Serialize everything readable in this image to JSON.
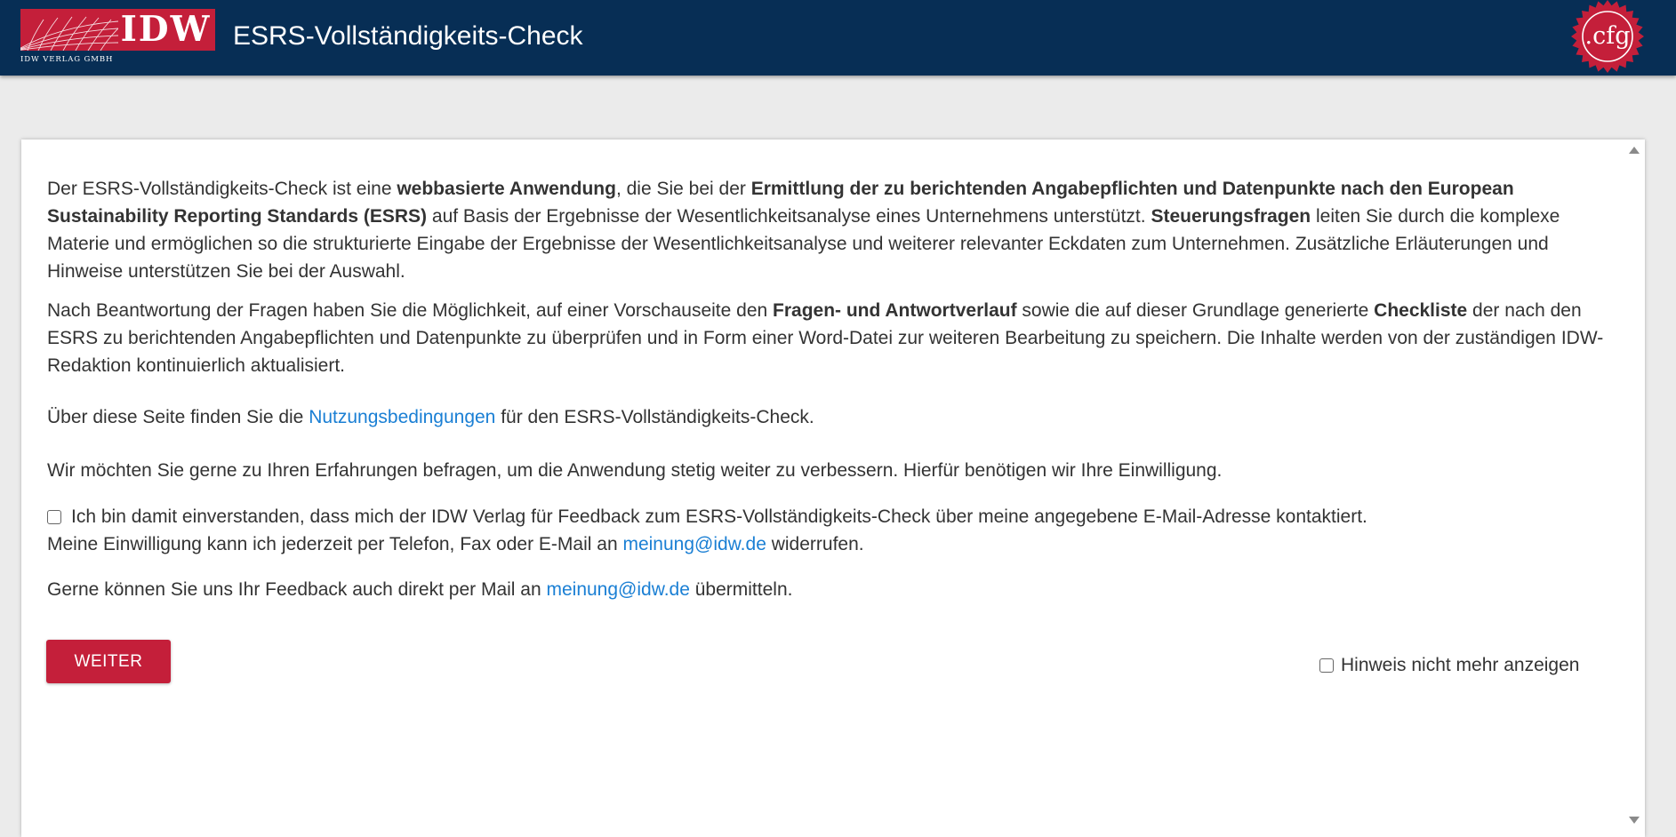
{
  "header": {
    "logo_text": "IDW",
    "logo_subtitle": "IDW VERLAG GMBH",
    "app_title": "ESRS-Vollständigkeits-Check",
    "badge_text": ".cfg"
  },
  "colors": {
    "header_bg": "#072e55",
    "brand_red": "#c41f3a",
    "link": "#1a7fd4",
    "page_bg": "#ebebeb"
  },
  "intro": {
    "p1": [
      {
        "t": "Der ESRS-Vollständigkeits-Check ist eine "
      },
      {
        "t": "webbasierte Anwendung",
        "b": true
      },
      {
        "t": ", die Sie bei der "
      },
      {
        "t": "Ermittlung der zu berichtenden Angabepflichten und Datenpunkte nach den European Sustainability Reporting Standards (ESRS)",
        "b": true
      },
      {
        "t": " auf Basis der Ergebnisse der Wesentlichkeitsanalyse eines Unternehmens unterstützt. "
      },
      {
        "t": "Steuerungsfragen",
        "b": true
      },
      {
        "t": " leiten Sie durch die komplexe Materie und ermöglichen so die strukturierte Eingabe der Ergebnisse der Wesentlichkeitsanalyse und weiterer relevanter Eckdaten zum Unternehmen. Zusätzliche Erläuterungen und Hinweise unterstützen Sie bei der Auswahl."
      }
    ],
    "p2": [
      {
        "t": "Nach Beantwortung der Fragen haben Sie die Möglichkeit, auf einer Vorschauseite den "
      },
      {
        "t": "Fragen- und Antwortverlauf",
        "b": true
      },
      {
        "t": " sowie die auf dieser Grundlage generierte "
      },
      {
        "t": "Checkliste",
        "b": true
      },
      {
        "t": " der nach den ESRS zu berichtenden Angabepflichten und Datenpunkte zu überprüfen und in Form einer Word-Datei zur weiteren Bearbeitung zu speichern. Die Inhalte werden von der zuständigen IDW-Redaktion kontinuierlich aktualisiert."
      }
    ]
  },
  "terms": {
    "before": "Über diese Seite finden Sie die ",
    "link": "Nutzungsbedingungen",
    "after": " für den ESRS-Vollständigkeits-Check."
  },
  "feedback_request": "Wir möchten Sie gerne zu Ihren Erfahrungen befragen, um die Anwendung stetig weiter zu verbessern. Hierfür benötigen wir Ihre Einwilligung.",
  "consent": {
    "checked": false,
    "line1": "Ich bin damit einverstanden, dass mich der IDW Verlag für Feedback zum ESRS-Vollständigkeits-Check über meine angegebene E-Mail-Adresse kontaktiert.",
    "line2_before": "Meine Einwilligung kann ich jederzeit per Telefon, Fax oder E-Mail an ",
    "line2_link": "meinung@idw.de",
    "line2_after": " widerrufen."
  },
  "mail": {
    "before": "Gerne können Sie uns Ihr Feedback auch direkt per Mail an ",
    "link": "meinung@idw.de",
    "after": " übermitteln."
  },
  "actions": {
    "continue_label": "WEITER",
    "hide_hint_label": "Hinweis nicht mehr anzeigen",
    "hide_hint_checked": false
  }
}
